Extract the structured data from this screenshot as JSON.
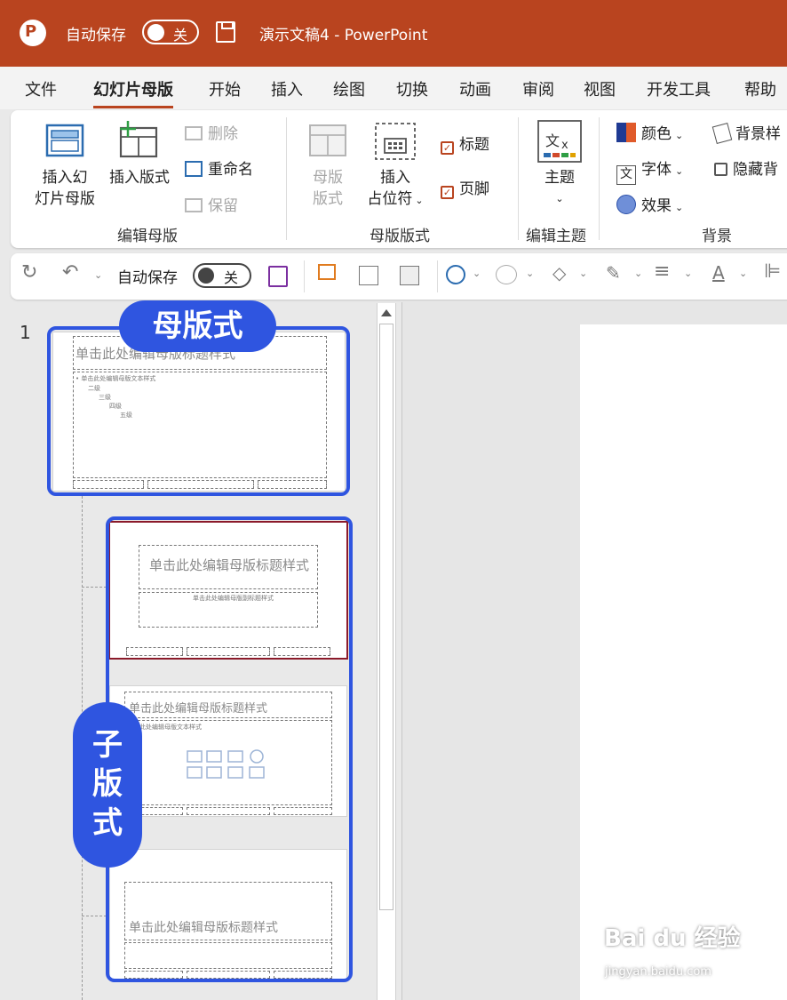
{
  "titlebar": {
    "app_icon_letter": "P",
    "autosave_label": "自动保存",
    "toggle_state": "关",
    "doc_title": "演示文稿4  -  PowerPoint"
  },
  "tabs": [
    "文件",
    "幻灯片母版",
    "开始",
    "插入",
    "绘图",
    "切换",
    "动画",
    "审阅",
    "视图",
    "开发工具",
    "帮助"
  ],
  "active_tab": "幻灯片母版",
  "ribbon": {
    "edit_master": {
      "label": "编辑母版",
      "insert_master_line1": "插入幻",
      "insert_master_line2": "灯片母版",
      "insert_layout": "插入版式",
      "delete": "删除",
      "rename": "重命名",
      "preserve": "保留"
    },
    "master_layout": {
      "label": "母版版式",
      "master_layout_line1": "母版",
      "master_layout_line2": "版式",
      "insert_placeholder_line1": "插入",
      "insert_placeholder_line2": "占位符",
      "title_checkbox": "标题",
      "footer_checkbox": "页脚"
    },
    "edit_theme": {
      "label": "编辑主题",
      "theme": "主题"
    },
    "background": {
      "label": "背景",
      "colors": "颜色",
      "fonts": "字体",
      "effects": "效果",
      "bg_styles": "背景样",
      "hide_bg": "隐藏背"
    }
  },
  "qat": {
    "autosave_label": "自动保存",
    "toggle_state": "关"
  },
  "thumbnails": {
    "slide_number": "1",
    "master_title": "单击此处编辑母版标题样式",
    "master_body": "• 单击此处编辑母版文本样式",
    "master_levels": [
      "二级",
      "三级",
      "四级",
      "五级"
    ],
    "layout1_title": "单击此处编辑母版标题样式",
    "layout1_subtitle": "单击此处编辑母版副标题样式",
    "layout2_title": "单击此处编辑母版标题样式",
    "layout2_body": "单击此处编辑母版文本样式",
    "layout3_title": "单击此处编辑母版标题样式"
  },
  "annotations": {
    "master_badge": "母版式",
    "child_badge_chars": [
      "子",
      "版",
      "式"
    ],
    "accent_color": "#2f55e0"
  },
  "watermark": {
    "brand": "Bai du 经验",
    "url": "jingyan.baidu.com"
  }
}
